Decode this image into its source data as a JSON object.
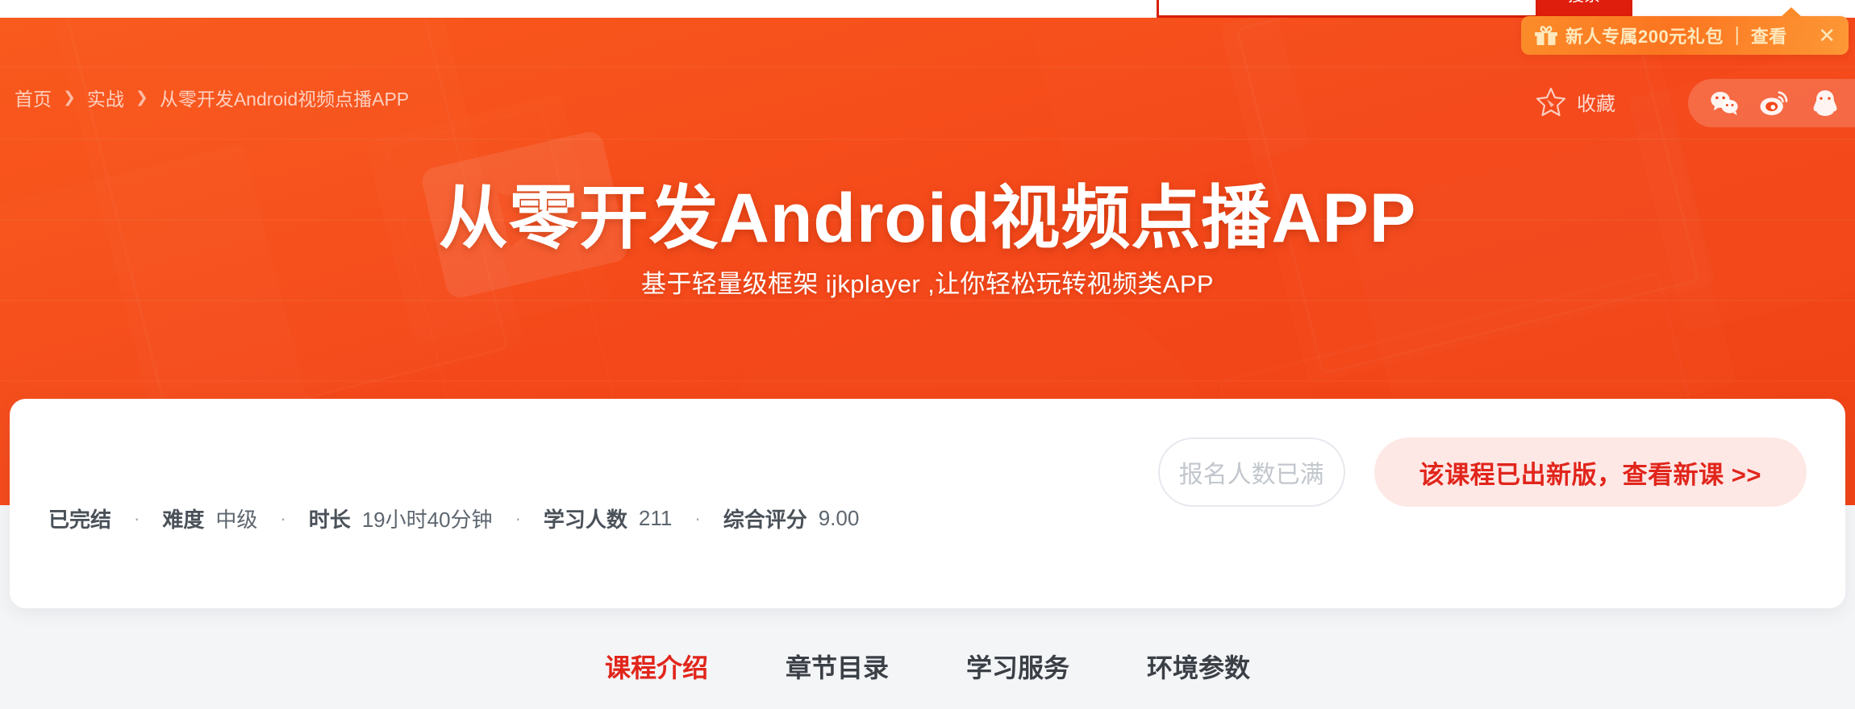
{
  "search": {
    "value": "",
    "placeholder": "",
    "button_label": "搜索"
  },
  "gift_banner": {
    "icon": "gift-icon",
    "text": "新人专属200元礼包",
    "separator": "｜",
    "action_label": "查看",
    "close_label": "✕",
    "bg_color": "#fb7f24",
    "text_color": "#fde9bd"
  },
  "breadcrumb": {
    "items": [
      {
        "label": "首页"
      },
      {
        "label": "实战"
      },
      {
        "label": "从零开发Android视频点播APP"
      }
    ],
    "separator": "❯"
  },
  "hero": {
    "title": "从零开发Android视频点播APP",
    "subtitle": "基于轻量级框架 ijkplayer ,让你轻松玩转视频类APP",
    "bg_color": "#f4481a"
  },
  "favorite": {
    "icon": "star-icon",
    "label": "收藏"
  },
  "share": {
    "items": [
      {
        "name": "wechat-icon",
        "label": "微信"
      },
      {
        "name": "weibo-icon",
        "label": "微博"
      },
      {
        "name": "qq-icon",
        "label": "QQ"
      }
    ]
  },
  "course_meta": {
    "status": "已完结",
    "difficulty_label": "难度",
    "difficulty_value": "中级",
    "duration_label": "时长",
    "duration_value": "19小时40分钟",
    "learners_label": "学习人数",
    "learners_value": "211",
    "rating_label": "综合评分",
    "rating_value": "9.00",
    "dot": "·"
  },
  "actions": {
    "enroll_full_label": "报名人数已满",
    "new_version_label": "该课程已出新版，查看新课 >>",
    "new_version_color": "#e1251b",
    "new_version_bg": "#fde8e6"
  },
  "tabs": {
    "items": [
      {
        "label": "课程介绍",
        "active": true
      },
      {
        "label": "章节目录",
        "active": false
      },
      {
        "label": "学习服务",
        "active": false
      },
      {
        "label": "环境参数",
        "active": false
      }
    ],
    "active_color": "#e1251b"
  }
}
